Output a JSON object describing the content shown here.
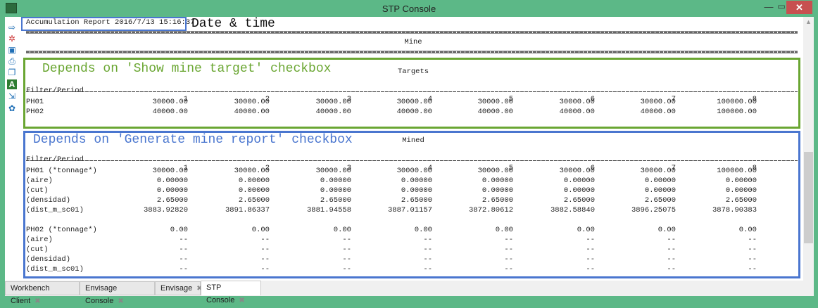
{
  "window": {
    "title": "STP Console",
    "close": "✕",
    "minimize": "—",
    "maximize": "▭"
  },
  "toolbar": {
    "icons": [
      "run-icon",
      "filter-icon",
      "save-icon",
      "print-icon",
      "copy-icon",
      "font-icon",
      "export-icon",
      "settings-icon"
    ]
  },
  "report": {
    "header": "Accumulation Report 2016/7/13 15:16:37",
    "section_title": "Mine",
    "targets": {
      "title": "Targets",
      "col_header": "Filter/Period",
      "periods": [
        "1",
        "2",
        "3",
        "4",
        "5",
        "6",
        "7",
        "8"
      ],
      "rows": [
        {
          "label": "PH01",
          "values": [
            "30000.00",
            "30000.00",
            "30000.00",
            "30000.00",
            "30000.00",
            "30000.00",
            "30000.00",
            "100000.00"
          ]
        },
        {
          "label": "PH02",
          "values": [
            "40000.00",
            "40000.00",
            "40000.00",
            "40000.00",
            "40000.00",
            "40000.00",
            "40000.00",
            "100000.00"
          ]
        }
      ]
    },
    "mined": {
      "title": "Mined",
      "col_header": "Filter/Period",
      "periods": [
        "1",
        "2",
        "3",
        "4",
        "5",
        "6",
        "7",
        "8"
      ],
      "rows": [
        {
          "label": "PH01 (*tonnage*)",
          "values": [
            "30000.00",
            "30000.00",
            "30000.00",
            "30000.00",
            "30000.00",
            "30000.00",
            "30000.00",
            "100000.00"
          ]
        },
        {
          "label": "(aire)",
          "values": [
            "0.00000",
            "0.00000",
            "0.00000",
            "0.00000",
            "0.00000",
            "0.00000",
            "0.00000",
            "0.00000"
          ]
        },
        {
          "label": "(cut)",
          "values": [
            "0.00000",
            "0.00000",
            "0.00000",
            "0.00000",
            "0.00000",
            "0.00000",
            "0.00000",
            "0.00000"
          ]
        },
        {
          "label": "(densidad)",
          "values": [
            "2.65000",
            "2.65000",
            "2.65000",
            "2.65000",
            "2.65000",
            "2.65000",
            "2.65000",
            "2.65000"
          ]
        },
        {
          "label": "(dist_m_sc01)",
          "values": [
            "3883.92820",
            "3891.86337",
            "3881.94558",
            "3887.01157",
            "3872.80612",
            "3882.58840",
            "3896.25075",
            "3878.90383"
          ]
        },
        {
          "label": "PH02 (*tonnage*)",
          "values": [
            "0.00",
            "0.00",
            "0.00",
            "0.00",
            "0.00",
            "0.00",
            "0.00",
            "0.00"
          ]
        },
        {
          "label": "(aire)",
          "values": [
            "--",
            "--",
            "--",
            "--",
            "--",
            "--",
            "--",
            "--"
          ]
        },
        {
          "label": "(cut)",
          "values": [
            "--",
            "--",
            "--",
            "--",
            "--",
            "--",
            "--",
            "--"
          ]
        },
        {
          "label": "(densidad)",
          "values": [
            "--",
            "--",
            "--",
            "--",
            "--",
            "--",
            "--",
            "--"
          ]
        },
        {
          "label": "(dist_m_sc01)",
          "values": [
            "--",
            "--",
            "--",
            "--",
            "--",
            "--",
            "--",
            "--"
          ]
        }
      ]
    }
  },
  "annotations": {
    "date_time": "Date & time",
    "targets_note": "Depends on 'Show mine target' checkbox",
    "mined_note": "Depends on 'Generate mine report' checkbox",
    "colors": {
      "blue": "#4a76cf",
      "green": "#6aa632"
    }
  },
  "tabs": [
    {
      "label": "Workbench Client",
      "close": "✖"
    },
    {
      "label": "Envisage Console",
      "close": "✖"
    },
    {
      "label": "Envisage",
      "close": "✖"
    },
    {
      "label": "STP Console",
      "close": "✖"
    }
  ]
}
